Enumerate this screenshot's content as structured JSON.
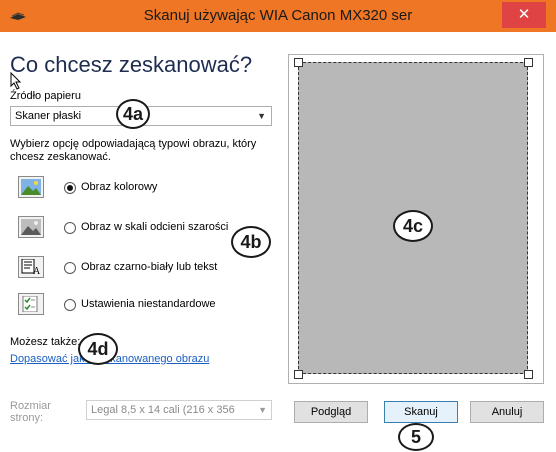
{
  "window": {
    "title": "Skanuj używając WIA Canon MX320 ser",
    "close_glyph": "✕"
  },
  "heading": "Co chcesz zeskanować?",
  "paper_source": {
    "label": "Źródło papieru",
    "value": "Skaner płaski"
  },
  "description": "Wybierz opcję odpowiadającą typowi obrazu, który chcesz zeskanować.",
  "options": [
    {
      "label": "Obraz kolorowy",
      "selected": true,
      "icon": "color-image-icon"
    },
    {
      "label": "Obraz w skali odcieni szarości",
      "selected": false,
      "icon": "grayscale-image-icon"
    },
    {
      "label": "Obraz czarno-biały lub tekst",
      "selected": false,
      "icon": "bw-text-icon"
    },
    {
      "label": "Ustawienia niestandardowe",
      "selected": false,
      "icon": "custom-settings-icon"
    }
  ],
  "more": {
    "label": "Możesz także:",
    "link": "Dopasować jakość skanowanego obrazu"
  },
  "page_size": {
    "label": "Rozmiar strony:",
    "value": "Legal 8,5 x 14 cali (216 x 356"
  },
  "buttons": {
    "preview": "Podgląd",
    "scan": "Skanuj",
    "cancel": "Anuluj"
  },
  "callouts": {
    "a": "4a",
    "b": "4b",
    "c": "4c",
    "d": "4d",
    "scan": "5"
  },
  "colors": {
    "titlebar": "#ef7625",
    "close": "#e04343",
    "link": "#1a5fc2",
    "preview": "#b8b8b8"
  }
}
